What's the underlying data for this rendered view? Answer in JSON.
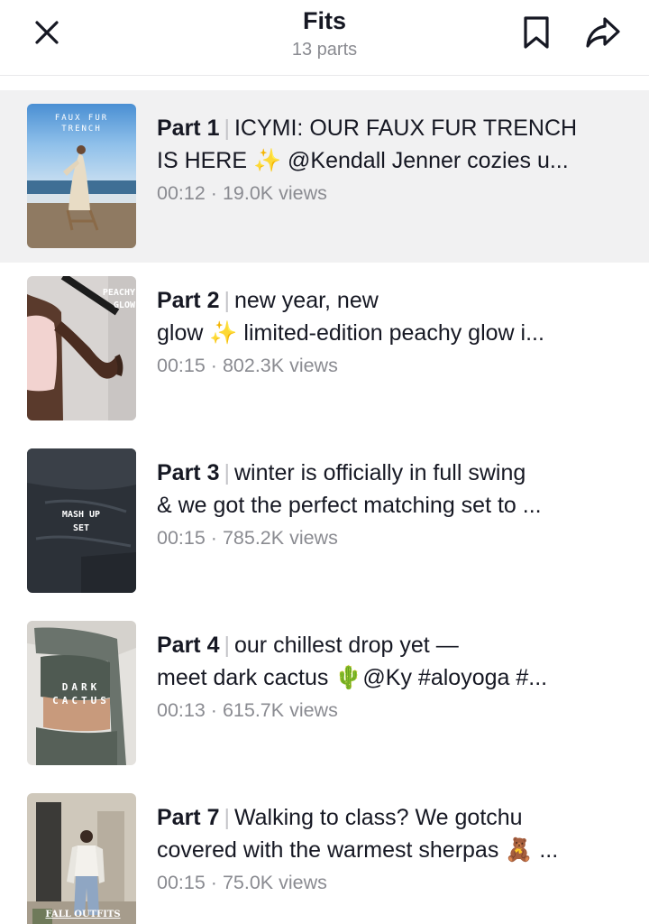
{
  "header": {
    "title": "Fits",
    "subtitle": "13 parts",
    "close_icon": "close-icon",
    "bookmark_icon": "bookmark-icon",
    "share_icon": "share-icon"
  },
  "parts": [
    {
      "part_label": "Part 1",
      "line1": "ICYMI: OUR FAUX FUR TRENCH",
      "line2": "IS HERE ✨ @Kendall Jenner cozies u...",
      "duration": "00:12",
      "views": "19.0K views",
      "thumb_text": "FAUX FUR TRENCH",
      "active": true
    },
    {
      "part_label": "Part 2",
      "line1": "new year, new",
      "line2": "glow ✨ limited-edition peachy glow i...",
      "duration": "00:15",
      "views": "802.3K views",
      "thumb_text": "PEACHY GLOW",
      "active": false
    },
    {
      "part_label": "Part 3",
      "line1": "winter is officially in full swing",
      "line2": "& we got the perfect matching set to ...",
      "duration": "00:15",
      "views": "785.2K views",
      "thumb_text": "MASH UP SET",
      "active": false
    },
    {
      "part_label": "Part 4",
      "line1": "our chillest drop yet —",
      "line2": "meet dark cactus 🌵@Ky #aloyoga #...",
      "duration": "00:13",
      "views": "615.7K views",
      "thumb_text": "DARK CACTUS",
      "active": false
    },
    {
      "part_label": "Part 7",
      "line1": "Walking to class? We gotchu",
      "line2": "covered with the warmest sherpas 🧸 ...",
      "duration": "00:15",
      "views": "75.0K views",
      "thumb_text": "FALL OUTFITS",
      "active": false
    }
  ],
  "meta_separator": "·",
  "colors": {
    "text": "#161823",
    "secondary": "#8a8b91",
    "active_row": "#f1f1f2",
    "divider": "#e8e8ea"
  }
}
